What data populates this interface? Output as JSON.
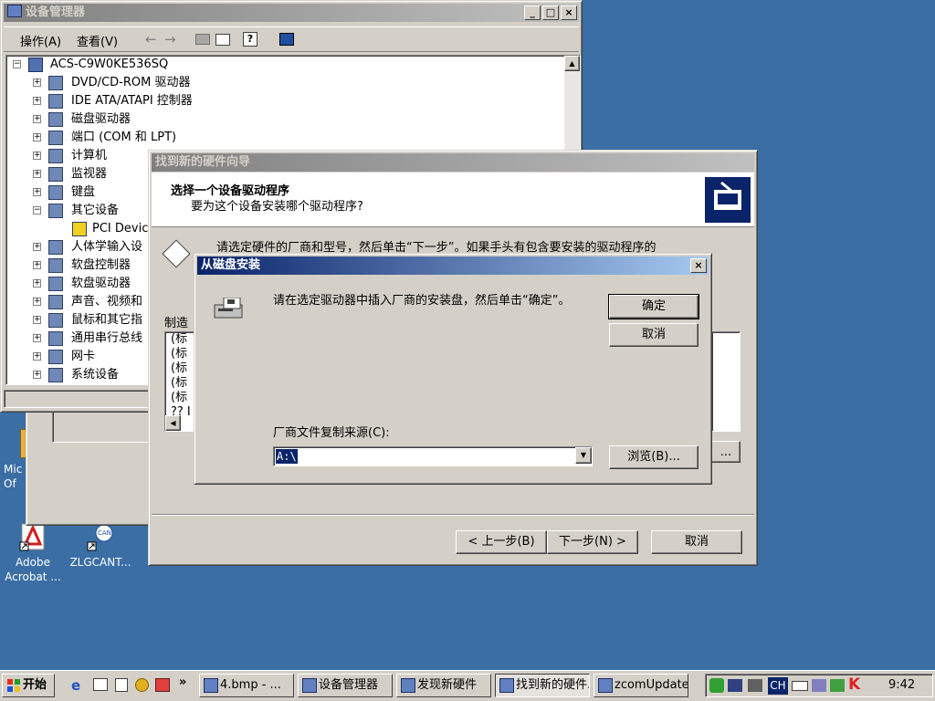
{
  "desktop": {
    "icons": [
      {
        "label": "Mic Of",
        "icon": "office-icon"
      },
      {
        "label": "Adobe Acrobat ...",
        "icon": "adobe-acrobat-icon"
      },
      {
        "label": "ZLGCANT...",
        "icon": "can-tool-icon"
      }
    ]
  },
  "device_manager": {
    "title": "设备管理器",
    "menu": {
      "action": "操作(A)",
      "view": "查看(V)"
    },
    "toolbar_icons": [
      "back-arrow-icon",
      "forward-arrow-icon",
      "folder-icon",
      "properties-icon",
      "help-icon",
      "monitor-icon"
    ],
    "tree": {
      "root": "ACS-C9W0KE536SQ",
      "items": [
        {
          "label": "DVD/CD-ROM 驱动器",
          "expander": "+"
        },
        {
          "label": "IDE ATA/ATAPI 控制器",
          "expander": "+"
        },
        {
          "label": "磁盘驱动器",
          "expander": "+"
        },
        {
          "label": "端口 (COM 和 LPT)",
          "expander": "+"
        },
        {
          "label": "计算机",
          "expander": "+"
        },
        {
          "label": "监视器",
          "expander": "+"
        },
        {
          "label": "键盘",
          "expander": "+"
        },
        {
          "label": "其它设备",
          "expander": "−"
        },
        {
          "label": "PCI Device",
          "expander": ""
        },
        {
          "label": "人体学输入设",
          "expander": "+"
        },
        {
          "label": "软盘控制器",
          "expander": "+"
        },
        {
          "label": "软盘驱动器",
          "expander": "+"
        },
        {
          "label": "声音、视频和",
          "expander": "+"
        },
        {
          "label": "鼠标和其它指",
          "expander": "+"
        },
        {
          "label": "通用串行总线",
          "expander": "+"
        },
        {
          "label": "网卡",
          "expander": "+"
        },
        {
          "label": "系统设备",
          "expander": "+"
        }
      ]
    }
  },
  "wizard": {
    "title": "找到新的硬件向导",
    "heading": "选择一个设备驱动程序",
    "subheading": "要为这个设备安装哪个驱动程序?",
    "instruction": "请选定硬件的厂商和型号，然后单击“下一步”。如果手头有包含要安装的驱动程序的",
    "manufacturer_label": "制造",
    "list_items": [
      "(标",
      "(标",
      "(标",
      "(标",
      "(标",
      "?? I"
    ],
    "disk_button": "...",
    "back_button": "< 上一步(B)",
    "next_button": "下一步(N) >",
    "cancel_button": "取消"
  },
  "install_dialog": {
    "title": "从磁盘安装",
    "close": "×",
    "message": "请在选定驱动器中插入厂商的安装盘，然后单击“确定”。",
    "ok_button": "确定",
    "cancel_button": "取消",
    "source_label": "厂商文件复制来源(C):",
    "source_value": "A:\\",
    "browse_button": "浏览(B)..."
  },
  "taskbar": {
    "start": "开始",
    "quick_more": "»",
    "tasks": [
      {
        "label": "4.bmp - ...",
        "pressed": false
      },
      {
        "label": "设备管理器",
        "pressed": false
      },
      {
        "label": "发现新硬件",
        "pressed": false
      },
      {
        "label": "找到新的硬件...",
        "pressed": true
      },
      {
        "label": "zcomUpdate",
        "pressed": false
      }
    ],
    "tray_lang": "CH",
    "clock": "9:42"
  },
  "colors": {
    "desktop": "#3a6ea5",
    "title_active": "#0a246a",
    "title_inactive": "#808080",
    "face": "#d4d0c8"
  }
}
